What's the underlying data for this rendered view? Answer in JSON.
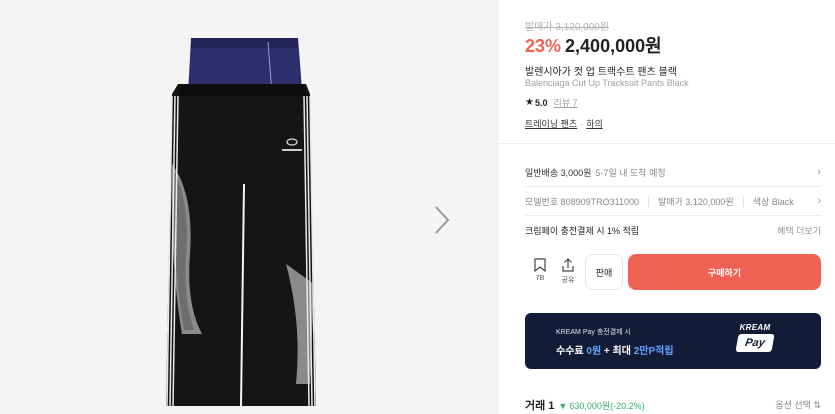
{
  "product": {
    "original_price": "발매가 3,120,000원",
    "discount": "23%",
    "price": "2,400,000원",
    "name_ko": "발렌시아가 컷 업 트랙수트 팬츠 블랙",
    "name_en": "Balenciaga Cut Up Tracksuit Pants Black",
    "rating": "5.0",
    "review_link": "리뷰 7",
    "category_1": "트레이닝 팬츠",
    "category_sep": "·",
    "category_2": "하의"
  },
  "shipping": {
    "label": "일반배송 3,000원",
    "eta": "5-7일 내 도착 예정"
  },
  "details": {
    "model": "모델번호 808909TRO311000",
    "release_price": "발매가 3,120,000원",
    "color": "색상 Black"
  },
  "kream_pay": {
    "text": "크림페이 충전결제 시 1% 적립",
    "more": "혜택 더보기"
  },
  "actions": {
    "bookmark_count": "7B",
    "share_label": "공유",
    "sell_label": "판매",
    "buy_label": "구매하기"
  },
  "banner": {
    "line1": "KREAM Pay 충전결제 시",
    "line2_a": "수수료 ",
    "line2_b": "0원",
    "line2_c": " + 최대 ",
    "line2_d": "2만P적립",
    "logo_top": "KREAM",
    "logo_bottom": "Pay"
  },
  "trade": {
    "label": "거래 1",
    "change": "630,000원(-20.2%)",
    "option_select": "옵션 선택 ⇅"
  },
  "colors": {
    "accent": "#ef6253",
    "down": "#31b46e",
    "banner_bg": "#121c36",
    "banner_highlight": "#61a3ff"
  },
  "icons": [
    "chevron-right-icon",
    "bookmark-icon",
    "share-icon",
    "star-icon",
    "down-triangle-icon"
  ]
}
